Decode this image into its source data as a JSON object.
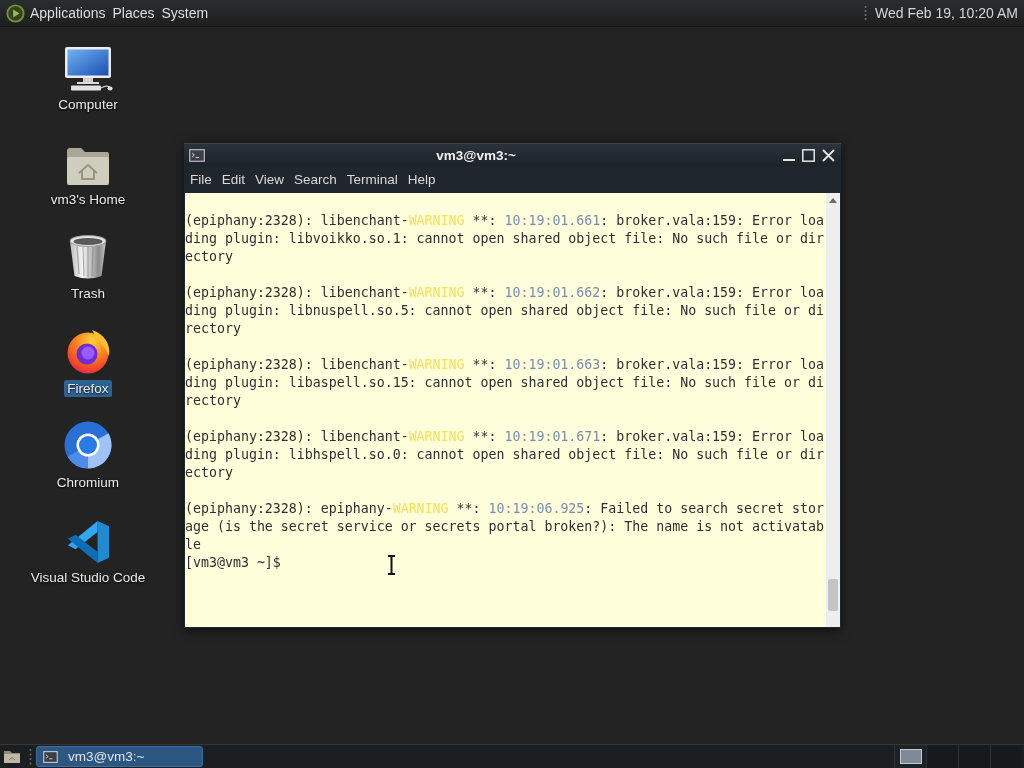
{
  "top_panel": {
    "menus": [
      "Applications",
      "Places",
      "System"
    ],
    "clock": "Wed Feb 19, 10:20 AM"
  },
  "desktop_icons": [
    {
      "kind": "computer",
      "label": "Computer",
      "selected": false
    },
    {
      "kind": "home",
      "label": "vm3's Home",
      "selected": false
    },
    {
      "kind": "trash",
      "label": "Trash",
      "selected": false
    },
    {
      "kind": "firefox",
      "label": "Firefox",
      "selected": true
    },
    {
      "kind": "chromium",
      "label": "Chromium",
      "selected": false
    },
    {
      "kind": "vscode",
      "label": "Visual Studio Code",
      "selected": false
    }
  ],
  "terminal": {
    "title": "vm3@vm3:~",
    "menu": [
      "File",
      "Edit",
      "View",
      "Search",
      "Terminal",
      "Help"
    ],
    "lines": [
      {
        "kind": "log",
        "segments": [
          {
            "kind": "text",
            "text": "(epiphany:2328): libenchant-"
          },
          {
            "kind": "level",
            "text": "WARNING"
          },
          {
            "kind": "text",
            "text": " **: "
          },
          {
            "kind": "time",
            "text": "10:19:01.661"
          },
          {
            "kind": "text",
            "text": ": broker.vala:159: Error loading plugin: libvoikko.so.1: cannot open shared object file: No such file or directory"
          }
        ]
      },
      {
        "kind": "log",
        "segments": [
          {
            "kind": "text",
            "text": "(epiphany:2328): libenchant-"
          },
          {
            "kind": "level",
            "text": "WARNING"
          },
          {
            "kind": "text",
            "text": " **: "
          },
          {
            "kind": "time",
            "text": "10:19:01.662"
          },
          {
            "kind": "text",
            "text": ": broker.vala:159: Error loading plugin: libnuspell.so.5: cannot open shared object file: No such file or directory"
          }
        ]
      },
      {
        "kind": "log",
        "segments": [
          {
            "kind": "text",
            "text": "(epiphany:2328): libenchant-"
          },
          {
            "kind": "level",
            "text": "WARNING"
          },
          {
            "kind": "text",
            "text": " **: "
          },
          {
            "kind": "time",
            "text": "10:19:01.663"
          },
          {
            "kind": "text",
            "text": ": broker.vala:159: Error loading plugin: libaspell.so.15: cannot open shared object file: No such file or directory"
          }
        ]
      },
      {
        "kind": "log",
        "segments": [
          {
            "kind": "text",
            "text": "(epiphany:2328): libenchant-"
          },
          {
            "kind": "level",
            "text": "WARNING"
          },
          {
            "kind": "text",
            "text": " **: "
          },
          {
            "kind": "time",
            "text": "10:19:01.671"
          },
          {
            "kind": "text",
            "text": ": broker.vala:159: Error loading plugin: libhspell.so.0: cannot open shared object file: No such file or directory"
          }
        ]
      },
      {
        "kind": "log",
        "segments": [
          {
            "kind": "text",
            "text": "(epiphany:2328): epiphany-"
          },
          {
            "kind": "level",
            "text": "WARNING"
          },
          {
            "kind": "text",
            "text": " **: "
          },
          {
            "kind": "time",
            "text": "10:19:06.925"
          },
          {
            "kind": "text",
            "text": ": Failed to search secret storage (is the secret service or secrets portal broken?): The name is not activatable"
          }
        ]
      },
      {
        "kind": "prompt",
        "text": "[vm3@vm3 ~]$"
      }
    ]
  },
  "taskbar": {
    "tasks": [
      {
        "label": "vm3@vm3:~",
        "selected": true
      }
    ],
    "workspaces": [
      {
        "selected": true
      },
      {
        "selected": false
      },
      {
        "selected": false
      },
      {
        "selected": false
      }
    ]
  }
}
